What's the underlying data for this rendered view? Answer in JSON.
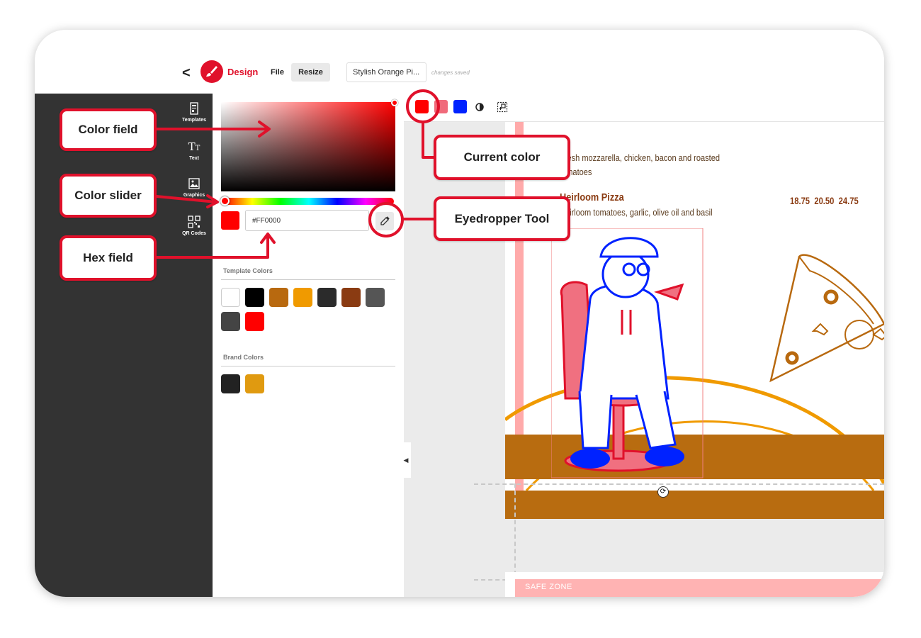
{
  "header": {
    "back_label": "<",
    "brand": "Design",
    "menu_file": "File",
    "menu_resize": "Resize",
    "document_title": "Stylish Orange Pi...",
    "save_status": "changes saved"
  },
  "rail": {
    "items": [
      {
        "label": "Templates",
        "icon": "templates-icon"
      },
      {
        "label": "Text",
        "icon": "text-icon"
      },
      {
        "label": "Graphics",
        "icon": "graphics-icon"
      },
      {
        "label": "QR Codes",
        "icon": "qr-code-icon"
      }
    ]
  },
  "color_panel": {
    "hex_value": "#FF0000",
    "current_color": "#ff0000",
    "template_colors_label": "Template Colors",
    "template_colors": [
      "#ffffff",
      "#000000",
      "#b8690f",
      "#f09a00",
      "#2b2b2b",
      "#8a3b12",
      "#555555",
      "#444444",
      "#ff0000"
    ],
    "brand_colors_label": "Brand Colors",
    "brand_colors": [
      "#222222",
      "#e09a10"
    ]
  },
  "toolbar": {
    "swatches": [
      "#ff0000",
      "#f06a7a",
      "#0022ff"
    ],
    "icons": [
      "contrast-icon",
      "layout-icon"
    ]
  },
  "menu": {
    "line1": "Fresh mozzarella, chicken, bacon and roasted",
    "line2": "tomatoes",
    "item_title": "Heirloom Pizza",
    "item_desc": "Heirloom tomatoes, garlic, olive oil and basil",
    "prices": "18.75  20.50  24.75"
  },
  "safe_zone": "SAFE ZONE",
  "callouts": {
    "color_field": "Color field",
    "color_slider": "Color slider",
    "hex_field": "Hex field",
    "current_color": "Current color",
    "eyedropper": "Eyedropper Tool"
  }
}
